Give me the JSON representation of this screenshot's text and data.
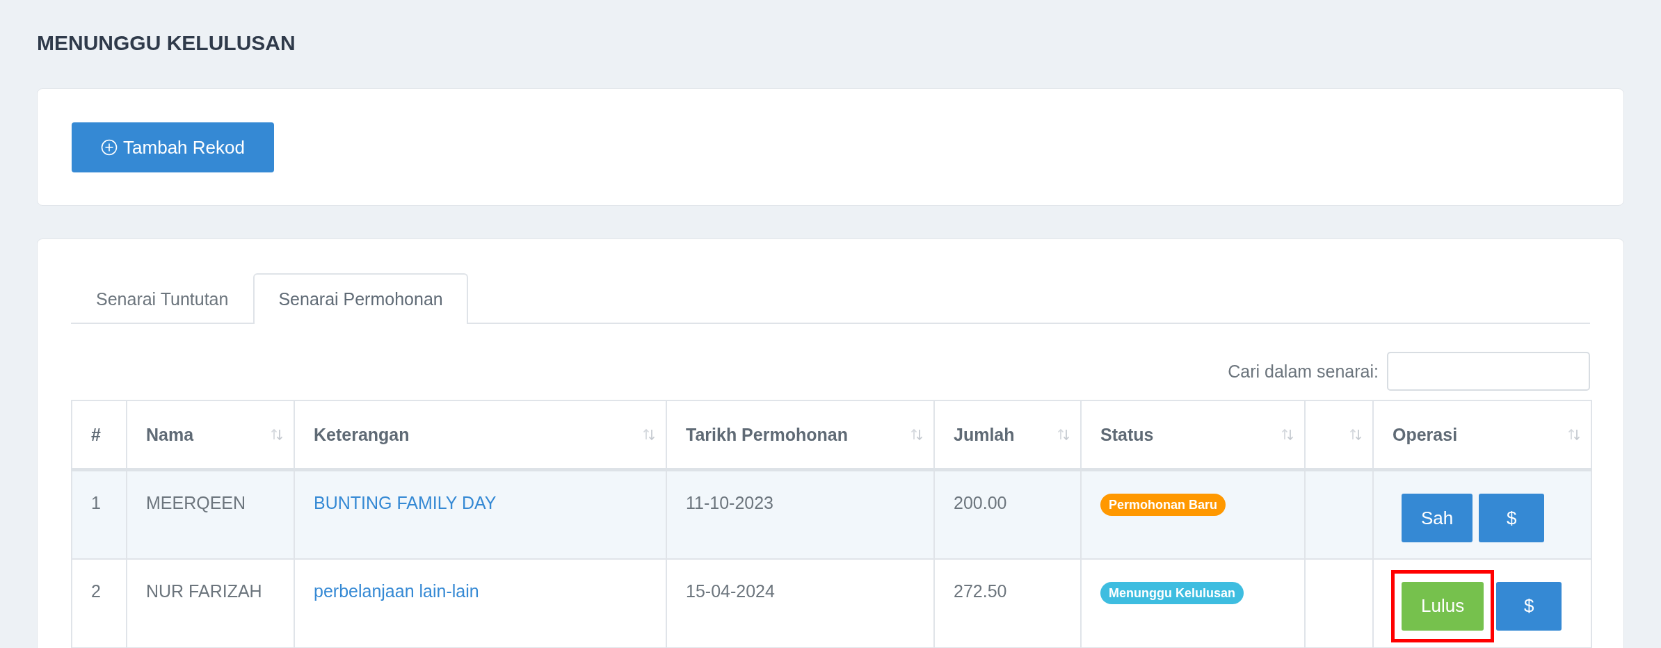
{
  "page_title": "MENUNGGU KELULUSAN",
  "add_button": {
    "label": "Tambah Rekod"
  },
  "tabs": [
    {
      "label": "Senarai Tuntutan",
      "selected": false
    },
    {
      "label": "Senarai Permohonan",
      "selected": true
    }
  ],
  "search": {
    "label": "Cari dalam senarai:"
  },
  "table": {
    "columns": [
      {
        "label": "#",
        "sortable": false
      },
      {
        "label": "Nama",
        "sortable": true
      },
      {
        "label": "Keterangan",
        "sortable": true
      },
      {
        "label": "Tarikh Permohonan",
        "sortable": true
      },
      {
        "label": "Jumlah",
        "sortable": true
      },
      {
        "label": "Status",
        "sortable": true
      },
      {
        "sortable": true
      },
      {
        "label": "Operasi",
        "sortable": true
      }
    ],
    "rows": [
      {
        "no": "1",
        "nama": "MEERQEEN",
        "keterangan": "BUNTING FAMILY DAY",
        "tarikh": "11-10-2023",
        "jumlah": "200.00",
        "status": {
          "label": "Permohonan Baru",
          "color": "#ff9800"
        },
        "actions": [
          {
            "label": "Sah",
            "kind": "primary",
            "highlighted": false
          },
          {
            "label": "$",
            "kind": "primary",
            "highlighted": false
          }
        ]
      },
      {
        "no": "2",
        "nama": "NUR FARIZAH",
        "keterangan": "perbelanjaan lain-lain",
        "tarikh": "15-04-2024",
        "jumlah": "272.50",
        "status": {
          "label": "Menunggu Kelulusan",
          "color": "#3ebde0"
        },
        "actions": [
          {
            "label": "Lulus",
            "kind": "success",
            "highlighted": true
          },
          {
            "label": "$",
            "kind": "primary",
            "highlighted": false
          }
        ]
      }
    ]
  }
}
